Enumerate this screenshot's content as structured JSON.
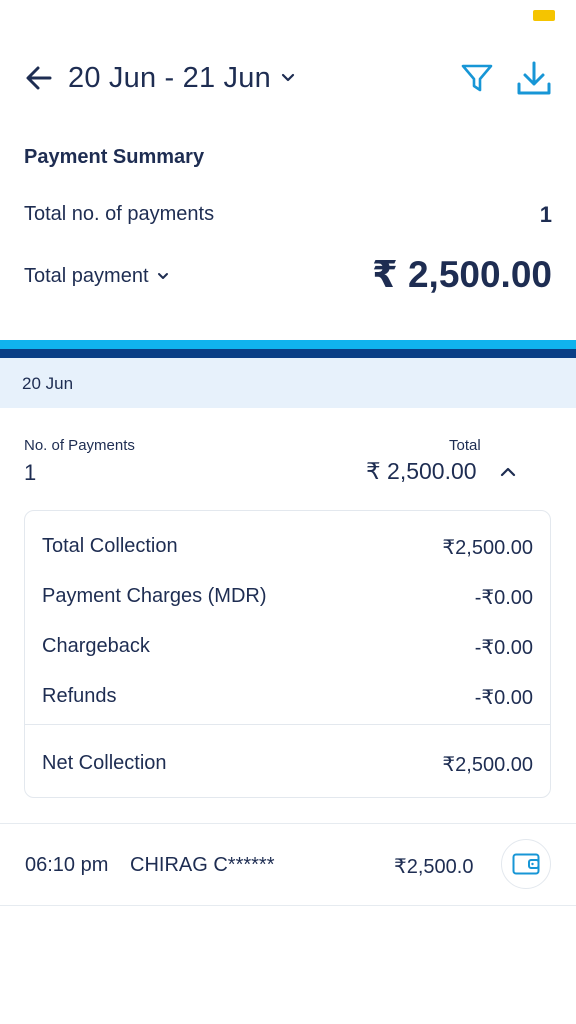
{
  "header": {
    "date_range": "20 Jun - 21 Jun",
    "back_icon": "arrow-left-icon",
    "filter_icon": "filter-icon",
    "download_icon": "download-icon"
  },
  "summary": {
    "title": "Payment Summary",
    "count_label": "Total no. of payments",
    "count_value": "1",
    "total_label": "Total payment",
    "total_value": "₹ 2,500.00"
  },
  "day_group": {
    "date": "20 Jun",
    "payments_label": "No. of Payments",
    "payments_value": "1",
    "total_label": "Total",
    "total_value": "₹ 2,500.00",
    "breakdown": [
      {
        "label": "Total Collection",
        "value": "₹2,500.00"
      },
      {
        "label": "Payment Charges (MDR)",
        "value": "-₹0.00"
      },
      {
        "label": "Chargeback",
        "value": "-₹0.00"
      },
      {
        "label": "Refunds",
        "value": "-₹0.00"
      }
    ],
    "net": {
      "label": "Net Collection",
      "value": "₹2,500.00"
    }
  },
  "transactions": [
    {
      "time": "06:10 pm",
      "name": "CHIRAG C******",
      "amount": "₹2,500.0",
      "icon": "wallet-icon"
    }
  ],
  "colors": {
    "primary_text": "#1e2d52",
    "accent_blue": "#1796d6",
    "bar_light": "#10b3ee",
    "bar_dark": "#0a3f86",
    "band_bg": "#e7f1fb",
    "status_yellow": "#f5c400"
  }
}
